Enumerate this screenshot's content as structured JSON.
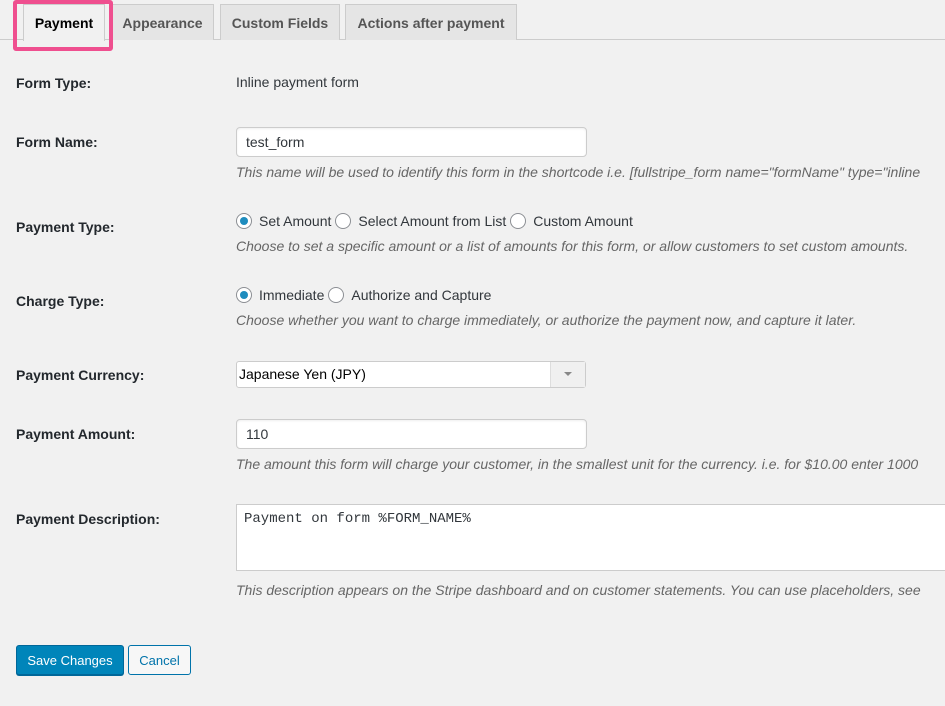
{
  "tabs": [
    {
      "label": "Payment",
      "active": true
    },
    {
      "label": "Appearance",
      "active": false
    },
    {
      "label": "Custom Fields",
      "active": false
    },
    {
      "label": "Actions after payment",
      "active": false
    }
  ],
  "form_type": {
    "label": "Form Type:",
    "value": "Inline payment form"
  },
  "form_name": {
    "label": "Form Name:",
    "value": "test_form",
    "description": "This name will be used to identify this form in the shortcode i.e. [fullstripe_form name=\"formName\" type=\"inline"
  },
  "payment_type": {
    "label": "Payment Type:",
    "options": [
      "Set Amount",
      "Select Amount from List",
      "Custom Amount"
    ],
    "selected": "Set Amount",
    "description": "Choose to set a specific amount or a list of amounts for this form, or allow customers to set custom amounts."
  },
  "charge_type": {
    "label": "Charge Type:",
    "options": [
      "Immediate",
      "Authorize and Capture"
    ],
    "selected": "Immediate",
    "description": "Choose whether you want to charge immediately, or authorize the payment now, and capture it later."
  },
  "payment_currency": {
    "label": "Payment Currency:",
    "value": "Japanese Yen (JPY)"
  },
  "payment_amount": {
    "label": "Payment Amount:",
    "value": "110",
    "description": "The amount this form will charge your customer, in the smallest unit for the currency. i.e. for $10.00 enter 1000"
  },
  "payment_description": {
    "label": "Payment Description:",
    "value": "Payment on form %FORM_NAME%",
    "description": "This description appears on the Stripe dashboard and on customer statements. You can use placeholders, see"
  },
  "buttons": {
    "save": "Save Changes",
    "cancel": "Cancel"
  },
  "colors": {
    "highlight": "#ef4f8f",
    "primary": "#0085ba",
    "radio_checked": "#1e8cbe"
  }
}
